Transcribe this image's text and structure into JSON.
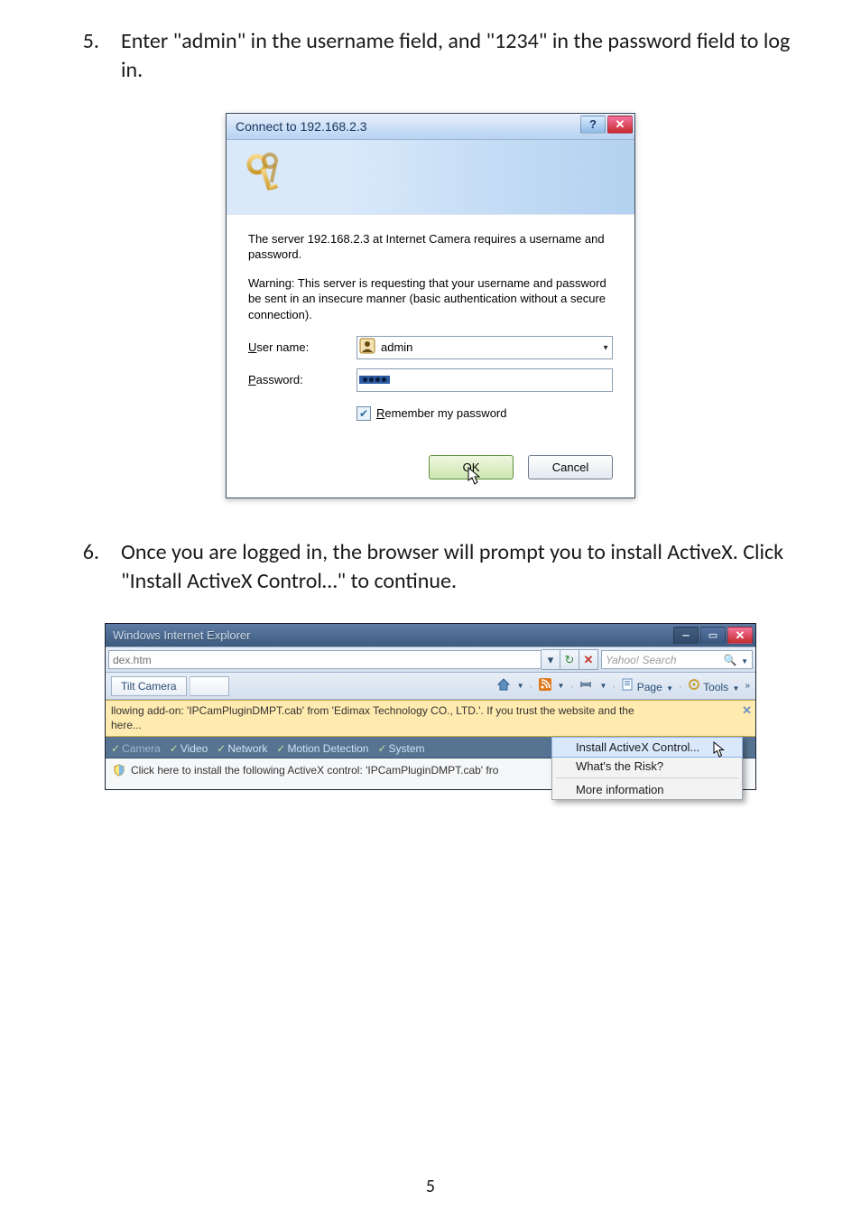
{
  "step5": {
    "number": "5.",
    "text": "Enter \"admin\" in the username field, and \"1234\" in the password field to log in."
  },
  "step6": {
    "number": "6.",
    "text": "Once you are logged in, the browser will prompt you to install ActiveX. Click \"Install ActiveX Control…\" to continue."
  },
  "dialog": {
    "title": "Connect to 192.168.2.3",
    "help_glyph": "?",
    "close_glyph": "✕",
    "message1": "The server 192.168.2.3 at Internet Camera requires a username and password.",
    "message2": "Warning: This server is requesting that your username and password be sent in an insecure manner (basic authentication without a secure connection).",
    "username_label_u": "U",
    "username_label_rest": "ser name:",
    "password_label_p": "P",
    "password_label_rest": "assword:",
    "username_value": "admin",
    "remember_r": "R",
    "remember_rest": "emember my password",
    "ok": "OK",
    "cancel": "Cancel"
  },
  "ie": {
    "title": "Windows Internet Explorer",
    "min_glyph": "–",
    "max_glyph": "▭",
    "close_glyph": "✕",
    "url_text": "dex.htm",
    "dd1": "▾",
    "refresh_glyph": "↻",
    "stop_glyph": "✕",
    "search_placeholder": "Yahoo! Search",
    "search_glyph": "🔍",
    "tab_label": "Tilt Camera",
    "tools_page": "Page",
    "tools_tools": "Tools",
    "tools_more": "»",
    "infobar_line1": "llowing add-on: 'IPCamPluginDMPT.cab' from 'Edimax Technology CO., LTD.'. If you trust the website and the",
    "infobar_line2": "here...",
    "infobar_x": "✕",
    "cam_tabs": [
      "Camera",
      "Video",
      "Network",
      "Motion Detection",
      "System"
    ],
    "click_here_text": "Click here to install the following ActiveX control: 'IPCamPluginDMPT.cab' fro",
    "menu_install": "Install ActiveX Control...",
    "menu_risk": "What's the Risk?",
    "menu_more": "More information",
    "cursor_glyph": "↖"
  },
  "page_number": "5"
}
